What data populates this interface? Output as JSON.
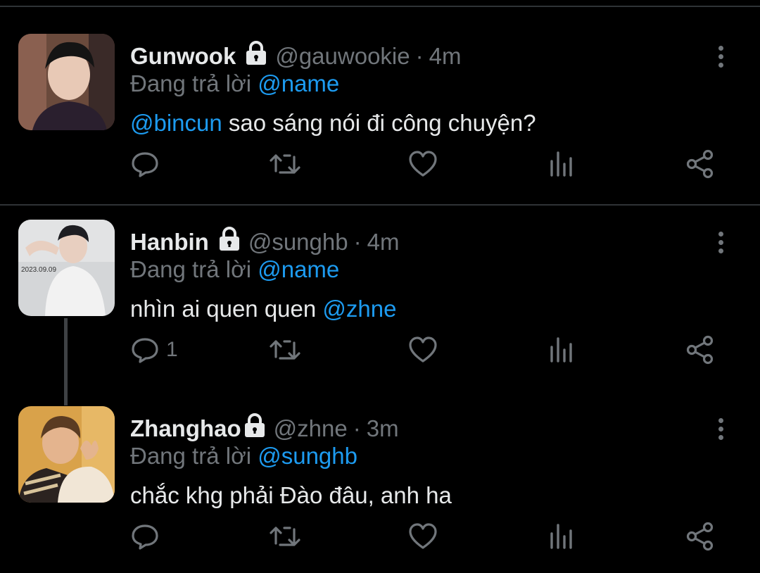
{
  "tweets": [
    {
      "display_name": "Gunwook",
      "handle": "@gauwookie",
      "separator": "·",
      "time": "4m",
      "replying_prefix": "Đang trả lời",
      "replying_to": "@name",
      "mention": "@bincun",
      "text": " sao sáng nói đi công chuyện?",
      "reply_count": ""
    },
    {
      "display_name": "Hanbin",
      "handle": "@sunghb",
      "separator": "·",
      "time": "4m",
      "replying_prefix": "Đang trả lời",
      "replying_to": "@name",
      "text": "nhìn ai quen quen ",
      "mention": "@zhne",
      "reply_count": "1"
    },
    {
      "display_name": "Zhanghao",
      "handle": "@zhne",
      "separator": "·",
      "time": "3m",
      "replying_prefix": "Đang trả lời",
      "replying_to": "@sunghb",
      "text": "chắc khg phải Đào đâu, anh ha",
      "reply_count": ""
    }
  ],
  "icons": {
    "lock": "lock-icon",
    "more": "more-icon",
    "reply": "reply-icon",
    "retweet": "retweet-icon",
    "like": "heart-icon",
    "views": "views-icon",
    "share": "share-icon"
  },
  "colors": {
    "background": "#000000",
    "text_primary": "#e7e9ea",
    "text_secondary": "#71767b",
    "accent": "#1d9bf0",
    "divider": "#2f3336"
  }
}
